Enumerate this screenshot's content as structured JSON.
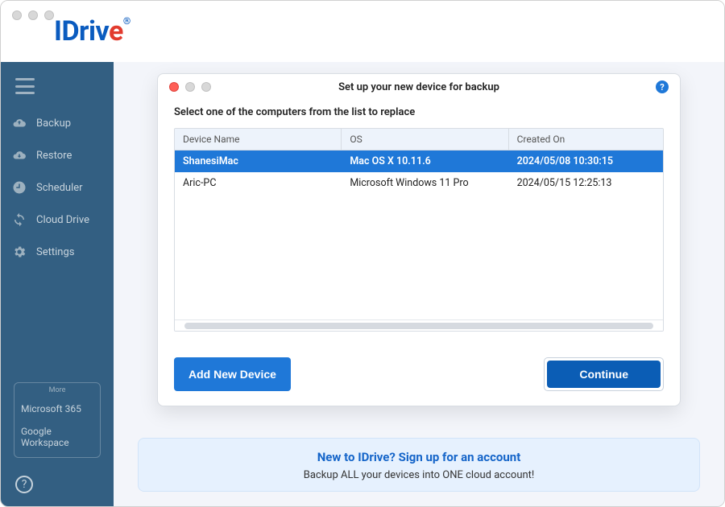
{
  "brand": {
    "name_left": "IDriv",
    "name_e": "e",
    "reg": "®"
  },
  "sidebar": {
    "items": [
      {
        "label": "Backup",
        "icon": "cloud-up-icon"
      },
      {
        "label": "Restore",
        "icon": "cloud-down-icon"
      },
      {
        "label": "Scheduler",
        "icon": "clock-icon"
      },
      {
        "label": "Cloud Drive",
        "icon": "sync-icon"
      },
      {
        "label": "Settings",
        "icon": "gear-icon"
      }
    ],
    "more_title": "More",
    "more": [
      {
        "label": "Microsoft 365"
      },
      {
        "label": "Google Workspace"
      }
    ]
  },
  "modal": {
    "title": "Set up your new device for backup",
    "instruction": "Select one of the computers from the list to replace",
    "columns": [
      "Device Name",
      "OS",
      "Created On"
    ],
    "rows": [
      {
        "device": "ShanesiMac",
        "os": "Mac OS X 10.11.6",
        "created": "2024/05/08 10:30:15",
        "selected": true
      },
      {
        "device": "Aric-PC",
        "os": "Microsoft Windows 11 Pro",
        "created": "2024/05/15 12:25:13",
        "selected": false
      }
    ],
    "add_label": "Add New Device",
    "continue_label": "Continue"
  },
  "banner": {
    "title": "New to IDrive? Sign up for an account",
    "subtitle": "Backup ALL your devices into ONE cloud account!"
  }
}
